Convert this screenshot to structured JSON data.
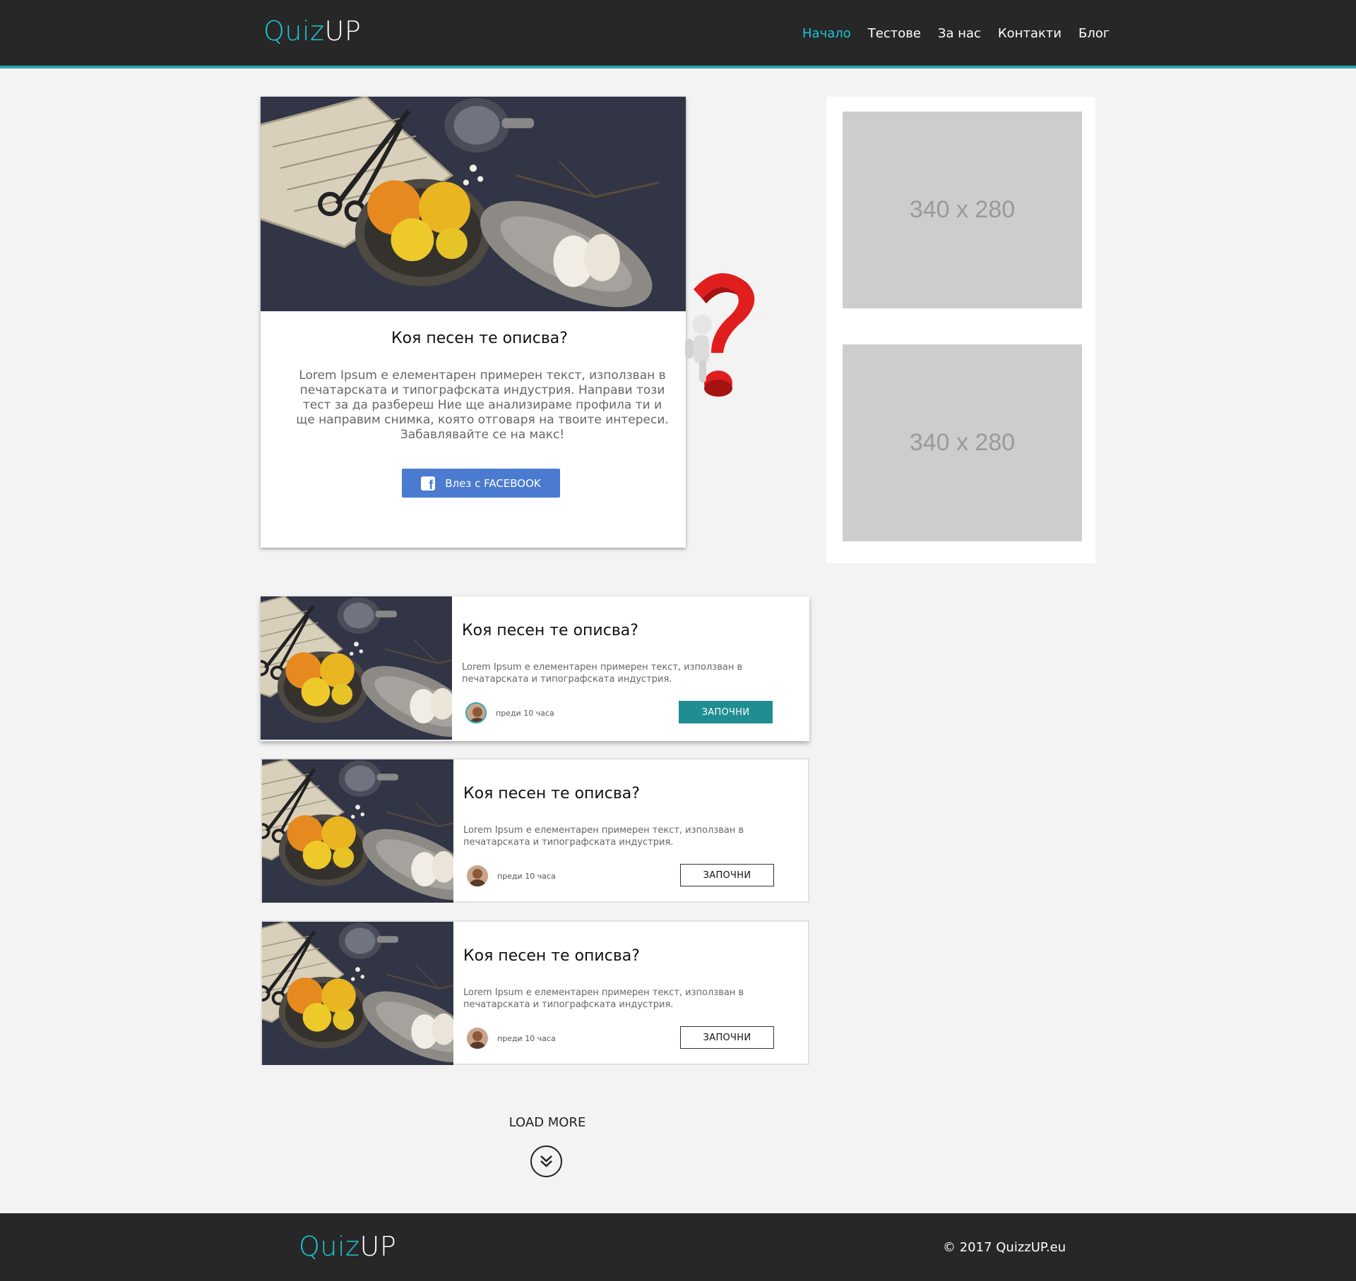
{
  "header": {
    "logo_part1": "Quiz",
    "logo_part2": "UP",
    "nav": [
      {
        "label": "Начало",
        "active": true
      },
      {
        "label": "Тестове"
      },
      {
        "label": "За нас"
      },
      {
        "label": "Контакти"
      },
      {
        "label": "Блог"
      }
    ]
  },
  "hero": {
    "title": "Коя песен те описва?",
    "text": "Lorem Ipsum е елементарен примерен текст, използван в печатарската и типографската индустрия. Направи този тест за да разбереш Ние ще анализираме профила ти и ще направим снимка, която отговаря на твоите интереси. Забавлявайте се на макс!",
    "fb_button": "Влез с FACEBOOK"
  },
  "ads": [
    {
      "label": "340 x 280"
    },
    {
      "label": "340 x 280"
    }
  ],
  "quizzes": [
    {
      "title": "Коя песен те описва?",
      "text": "Lorem Ipsum е елементарен примерен текст, използван  в печатарската и типографската индустрия.",
      "time": "преди 10 часа",
      "button": "ЗАПОЧНИ"
    },
    {
      "title": "Коя песен те описва?",
      "text": "Lorem Ipsum е елементарен примерен текст, използван  в печатарската и типографската индустрия.",
      "time": "преди 10 часа",
      "button": "ЗАПОЧНИ"
    },
    {
      "title": "Коя песен те описва?",
      "text": "Lorem Ipsum е елементарен примерен текст, използван  в печатарската и типографската индустрия.",
      "time": "преди 10 часа",
      "button": "ЗАПОЧНИ"
    }
  ],
  "load_more": "LOAD MORE",
  "footer": {
    "logo_part1": "Quiz",
    "logo_part2": "UP",
    "copyright": "© 2017 QuizzUP.eu"
  },
  "colors": {
    "accent": "#1fc3d3",
    "header_bg": "#272727",
    "button_teal": "#1f8e92",
    "facebook": "#4a7bd0"
  }
}
